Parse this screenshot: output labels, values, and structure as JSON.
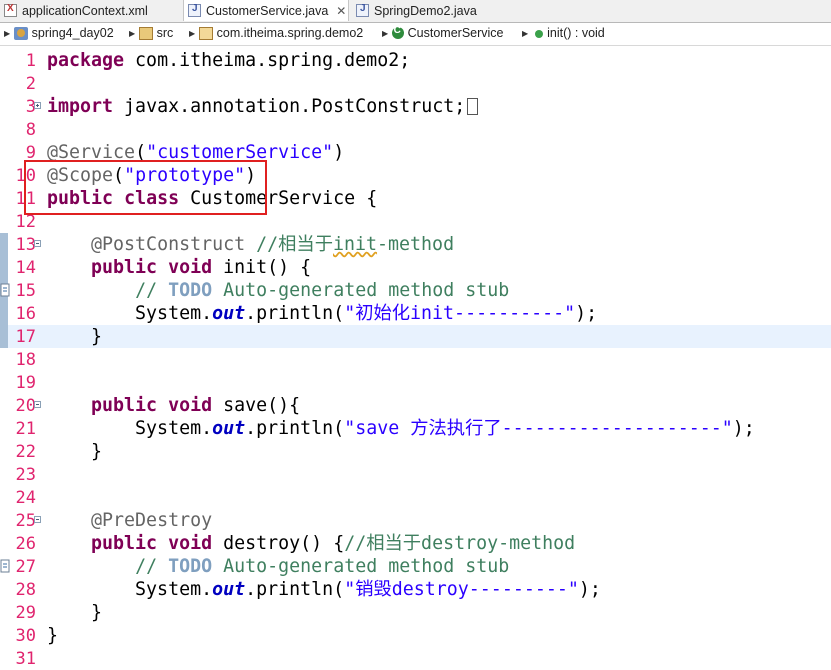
{
  "tabs": [
    {
      "label": "applicationContext.xml",
      "icon": "xml-file-icon",
      "active": false
    },
    {
      "label": "CustomerService.java",
      "icon": "java-file-icon",
      "active": true,
      "close": "✕"
    },
    {
      "label": "SpringDemo2.java",
      "icon": "java-file-icon",
      "active": false
    }
  ],
  "breadcrumb": {
    "project": "spring4_day02",
    "folder": "src",
    "package": "com.itheima.spring.demo2",
    "class": "CustomerService",
    "method": "init() : void"
  },
  "lines": [
    {
      "n": "1",
      "segs": [
        [
          "kw",
          "package"
        ],
        [
          "",
          "&nbsp;com.itheima.spring.demo2;"
        ]
      ]
    },
    {
      "n": "2",
      "segs": []
    },
    {
      "n": "3",
      "segs": [
        [
          "kw",
          "import"
        ],
        [
          "",
          "&nbsp;javax.annotation.PostConstruct;"
        ]
      ]
    },
    {
      "n": "8",
      "segs": []
    },
    {
      "n": "9",
      "segs": [
        [
          "an",
          "@Service"
        ],
        [
          "",
          "("
        ],
        [
          "str",
          "\"customerService\""
        ],
        [
          "",
          ")"
        ]
      ]
    },
    {
      "n": "10",
      "segs": [
        [
          "an",
          "@Scope"
        ],
        [
          "",
          "("
        ],
        [
          "str",
          "\"prototype\""
        ],
        [
          "",
          ")"
        ]
      ]
    },
    {
      "n": "11",
      "segs": [
        [
          "kw",
          "public"
        ],
        [
          "",
          "&nbsp;"
        ],
        [
          "kw",
          "class"
        ],
        [
          "",
          "&nbsp;CustomerService {"
        ]
      ]
    },
    {
      "n": "12",
      "segs": []
    },
    {
      "n": "13",
      "segs": [
        [
          "",
          "&nbsp;&nbsp;&nbsp;&nbsp;"
        ],
        [
          "an",
          "@PostConstruct"
        ],
        [
          "",
          "&nbsp;"
        ],
        [
          "cm",
          "//相当于"
        ],
        [
          "cm sq",
          "init"
        ],
        [
          "cm",
          "-method"
        ]
      ]
    },
    {
      "n": "14",
      "segs": [
        [
          "",
          "&nbsp;&nbsp;&nbsp;&nbsp;"
        ],
        [
          "kw",
          "public"
        ],
        [
          "",
          "&nbsp;"
        ],
        [
          "kw",
          "void"
        ],
        [
          "",
          "&nbsp;init() {"
        ]
      ]
    },
    {
      "n": "15",
      "segs": [
        [
          "",
          "&nbsp;&nbsp;&nbsp;&nbsp;&nbsp;&nbsp;&nbsp;&nbsp;"
        ],
        [
          "cm",
          "//&nbsp;"
        ],
        [
          "cmb",
          "TODO"
        ],
        [
          "cm",
          "&nbsp;Auto-generated method stub"
        ]
      ]
    },
    {
      "n": "16",
      "segs": [
        [
          "",
          "&nbsp;&nbsp;&nbsp;&nbsp;&nbsp;&nbsp;&nbsp;&nbsp;System."
        ],
        [
          "fld",
          "out"
        ],
        [
          "",
          ".println("
        ],
        [
          "str",
          "\"初始化init----------\""
        ],
        [
          "",
          ");"
        ]
      ]
    },
    {
      "n": "17",
      "segs": [
        [
          "",
          "&nbsp;&nbsp;&nbsp;&nbsp;}"
        ]
      ]
    },
    {
      "n": "18",
      "segs": []
    },
    {
      "n": "19",
      "segs": []
    },
    {
      "n": "20",
      "segs": [
        [
          "",
          "&nbsp;&nbsp;&nbsp;&nbsp;"
        ],
        [
          "kw",
          "public"
        ],
        [
          "",
          "&nbsp;"
        ],
        [
          "kw",
          "void"
        ],
        [
          "",
          "&nbsp;save(){"
        ]
      ]
    },
    {
      "n": "21",
      "segs": [
        [
          "",
          "&nbsp;&nbsp;&nbsp;&nbsp;&nbsp;&nbsp;&nbsp;&nbsp;System."
        ],
        [
          "fld",
          "out"
        ],
        [
          "",
          ".println("
        ],
        [
          "str",
          "\"save 方法执行了--------------------\""
        ],
        [
          "",
          ");"
        ]
      ]
    },
    {
      "n": "22",
      "segs": [
        [
          "",
          "&nbsp;&nbsp;&nbsp;&nbsp;}"
        ]
      ]
    },
    {
      "n": "23",
      "segs": []
    },
    {
      "n": "24",
      "segs": []
    },
    {
      "n": "25",
      "segs": [
        [
          "",
          "&nbsp;&nbsp;&nbsp;&nbsp;"
        ],
        [
          "an",
          "@PreDestroy"
        ]
      ]
    },
    {
      "n": "26",
      "segs": [
        [
          "",
          "&nbsp;&nbsp;&nbsp;&nbsp;"
        ],
        [
          "kw",
          "public"
        ],
        [
          "",
          "&nbsp;"
        ],
        [
          "kw",
          "void"
        ],
        [
          "",
          "&nbsp;destroy() {"
        ],
        [
          "cm",
          "//相当于destroy-method"
        ]
      ]
    },
    {
      "n": "27",
      "segs": [
        [
          "",
          "&nbsp;&nbsp;&nbsp;&nbsp;&nbsp;&nbsp;&nbsp;&nbsp;"
        ],
        [
          "cm",
          "//&nbsp;"
        ],
        [
          "cmb",
          "TODO"
        ],
        [
          "cm",
          "&nbsp;Auto-generated method stub"
        ]
      ]
    },
    {
      "n": "28",
      "segs": [
        [
          "",
          "&nbsp;&nbsp;&nbsp;&nbsp;&nbsp;&nbsp;&nbsp;&nbsp;System."
        ],
        [
          "fld",
          "out"
        ],
        [
          "",
          ".println("
        ],
        [
          "str",
          "\"销毁destroy---------\""
        ],
        [
          "",
          ");"
        ]
      ]
    },
    {
      "n": "29",
      "segs": [
        [
          "",
          "&nbsp;&nbsp;&nbsp;&nbsp;}"
        ]
      ]
    },
    {
      "n": "30",
      "segs": [
        [
          "",
          "}"
        ]
      ]
    },
    {
      "n": "31",
      "segs": []
    }
  ]
}
